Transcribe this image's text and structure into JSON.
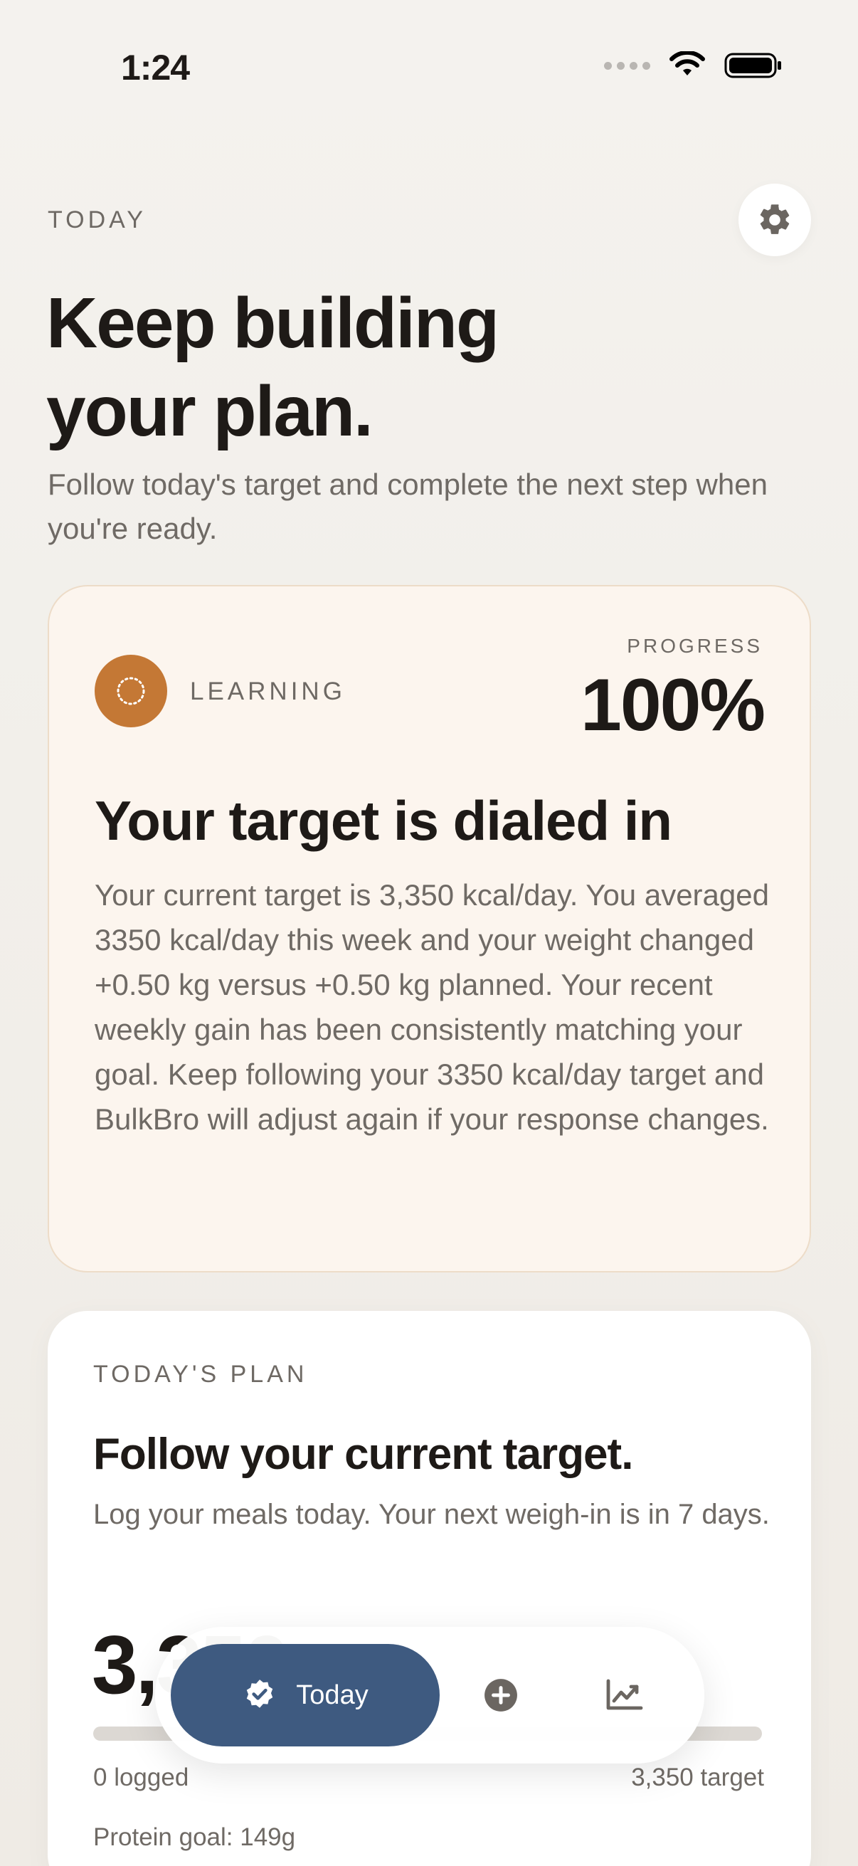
{
  "status_bar": {
    "time": "1:24"
  },
  "header": {
    "eyebrow": "TODAY",
    "headline_line1": "Keep building",
    "headline_line2": "your plan.",
    "subhead": "Follow today's target and complete the next step when you're ready."
  },
  "learning_card": {
    "badge_label": "LEARNING",
    "progress_label": "PROGRESS",
    "progress_value": "100%",
    "title": "Your target is dialed in",
    "body": "Your current target is 3,350 kcal/day. You averaged 3350 kcal/day this week and your weight changed +0.50 kg versus +0.50 kg planned. Your recent weekly gain has been consistently matching your goal. Keep following your 3350 kcal/day target and BulkBro will adjust again if your response changes.",
    "accent_color": "#c47835"
  },
  "plan_card": {
    "eyebrow": "TODAY'S PLAN",
    "title": "Follow your current target.",
    "body": "Log your meals today. Your next weigh-in is in 7 days.",
    "big_number": "3,350",
    "logged": "0 logged",
    "target": "3,350 target",
    "protein": "Protein goal: 149g",
    "logged_fraction": 0
  },
  "tab_bar": {
    "today_label": "Today",
    "today_icon": "verified-check-icon",
    "add_icon": "plus-circle-icon",
    "chart_icon": "trend-chart-icon",
    "active_color": "#3e5a80"
  }
}
